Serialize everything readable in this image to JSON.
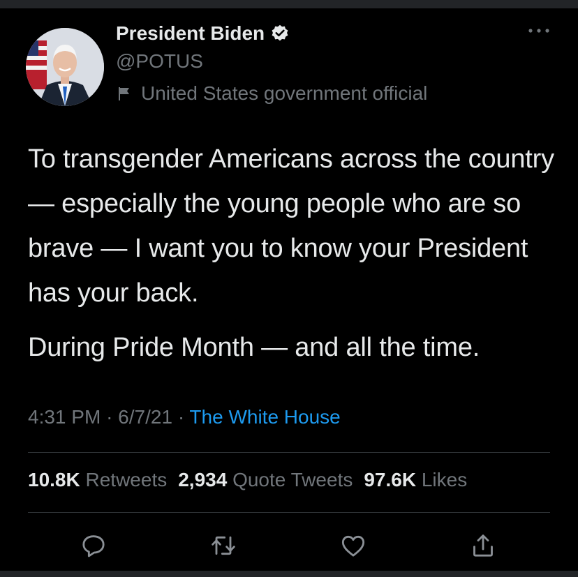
{
  "tweet": {
    "display_name": "President Biden",
    "handle": "@POTUS",
    "account_label": "United States government official",
    "body_paragraphs": [
      "To transgender Americans across the country — especially the young people who are so brave — I want you to know your President has your back.",
      "During Pride Month — and all the time."
    ],
    "time": "4:31 PM",
    "date": "6/7/21",
    "separator": "·",
    "source": "The White House",
    "stats": {
      "retweets": {
        "count": "10.8K",
        "label": "Retweets"
      },
      "quote_tweets": {
        "count": "2,934",
        "label": "Quote Tweets"
      },
      "likes": {
        "count": "97.6K",
        "label": "Likes"
      }
    }
  },
  "icons": {
    "verified": "verified-badge-icon",
    "label_flag": "flag-icon",
    "more": "more-options-icon",
    "reply": "reply-icon",
    "retweet": "retweet-icon",
    "like": "heart-icon",
    "share": "share-icon"
  },
  "colors": {
    "background": "#000000",
    "text": "#e7e9ea",
    "muted": "#71767b",
    "link": "#1d9bf0"
  }
}
